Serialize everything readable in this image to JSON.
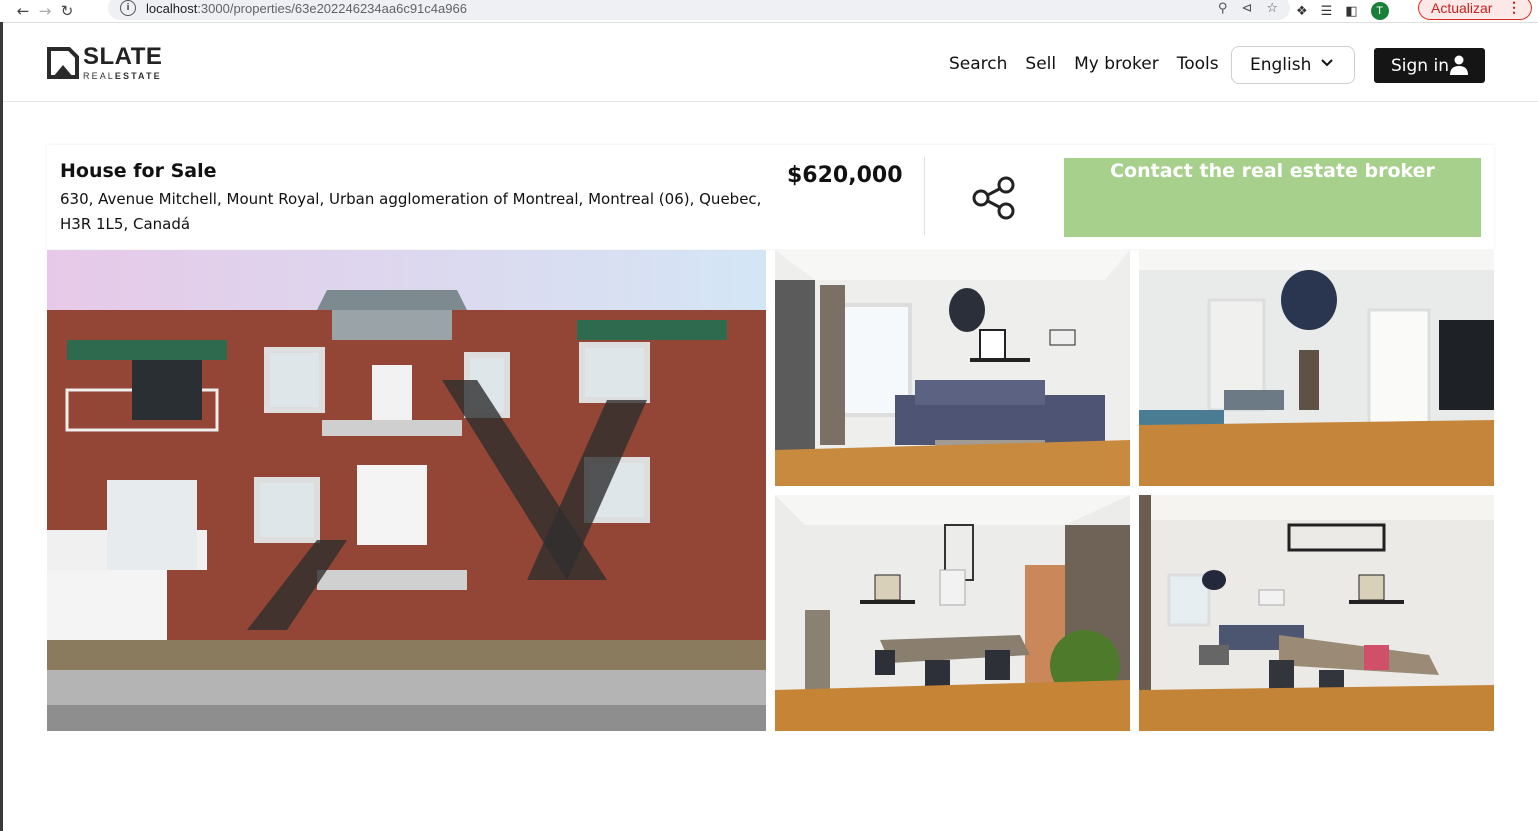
{
  "browser": {
    "url_host": "localhost",
    "url_path": ":3000/properties/63e202246234aa6c91c4a966",
    "update_button": "Actualizar",
    "profile_initial": "T"
  },
  "header": {
    "logo_word": "SLATE",
    "logo_sub_light": "REAL",
    "logo_sub_bold": "ESTATE",
    "nav": [
      "Search",
      "Sell",
      "My broker",
      "Tools"
    ],
    "language": "English",
    "signin": "Sign in"
  },
  "listing": {
    "title": "House for Sale",
    "address": "630, Avenue Mitchell, Mount Royal, Urban agglomeration of Montreal, Montreal (06), Quebec, H3R 1L5, Canadá",
    "price": "$620,000",
    "contact_button": "Contact the real estate broker",
    "contact_color": "#a8d08d"
  },
  "photos": [
    {
      "name": "exterior-photo",
      "subject": "brick triplex facade with outdoor staircases"
    },
    {
      "name": "living-room-photo",
      "subject": "living room with grey sofa"
    },
    {
      "name": "dining-living-photo",
      "subject": "dining and living area"
    },
    {
      "name": "dining-room-photo",
      "subject": "dining table with chairs"
    },
    {
      "name": "open-space-photo",
      "subject": "open dining and living space"
    }
  ]
}
